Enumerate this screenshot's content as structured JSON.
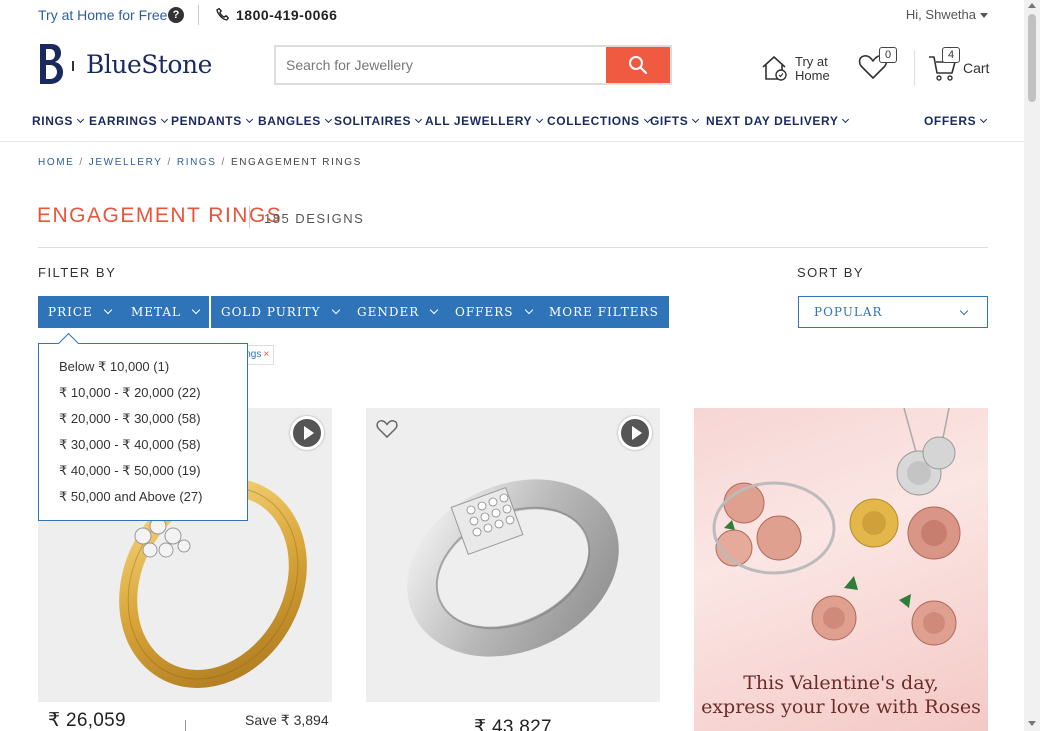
{
  "topbar": {
    "try_home_free": "Try at Home for Free",
    "help_icon": "question-circle-icon",
    "phone_icon": "phone-icon",
    "phone": "1800-419-0066",
    "greeting": "Hi, Shwetha"
  },
  "header": {
    "logo_text": "BlueStone",
    "search_placeholder": "Search for Jewellery",
    "try_home_line1": "Try at",
    "try_home_line2": "Home",
    "wishlist_count": "0",
    "cart_count": "4",
    "cart_label": "Cart",
    "search_button_color": "#f05a40"
  },
  "nav": {
    "items": [
      "RINGS",
      "EARRINGS",
      "PENDANTS",
      "BANGLES",
      "SOLITAIRES",
      "ALL JEWELLERY",
      "COLLECTIONS",
      "GIFTS",
      "NEXT DAY DELIVERY"
    ],
    "offers": "OFFERS"
  },
  "breadcrumb": {
    "items": [
      "HOME",
      "JEWELLERY",
      "RINGS"
    ],
    "current": "ENGAGEMENT RINGS"
  },
  "page": {
    "title": "ENGAGEMENT RINGS",
    "count": "185 DESIGNS",
    "title_color": "#e9553b"
  },
  "filters": {
    "label": "FILTER BY",
    "buttons": [
      "PRICE",
      "METAL",
      "GOLD PURITY",
      "GENDER",
      "OFFERS",
      "MORE FILTERS"
    ],
    "active_tag": "ings",
    "accent_color": "#2f74b8"
  },
  "sort": {
    "label": "SORT BY",
    "value": "POPULAR"
  },
  "price_dropdown": {
    "options": [
      "Below ₹  10,000 (1)",
      "₹  10,000 - ₹  20,000 (22)",
      "₹  20,000 - ₹  30,000 (58)",
      "₹  30,000 - ₹  40,000 (58)",
      "₹  40,000 - ₹  50,000 (19)",
      "₹  50,000 and Above (27)"
    ]
  },
  "products": [
    {
      "price": "₹ 26,059",
      "save": "Save ₹ 3,894"
    },
    {
      "price": "₹ 43,827"
    }
  ],
  "promo": {
    "line1": "This Valentine's day,",
    "line2": "express your love with Roses"
  }
}
